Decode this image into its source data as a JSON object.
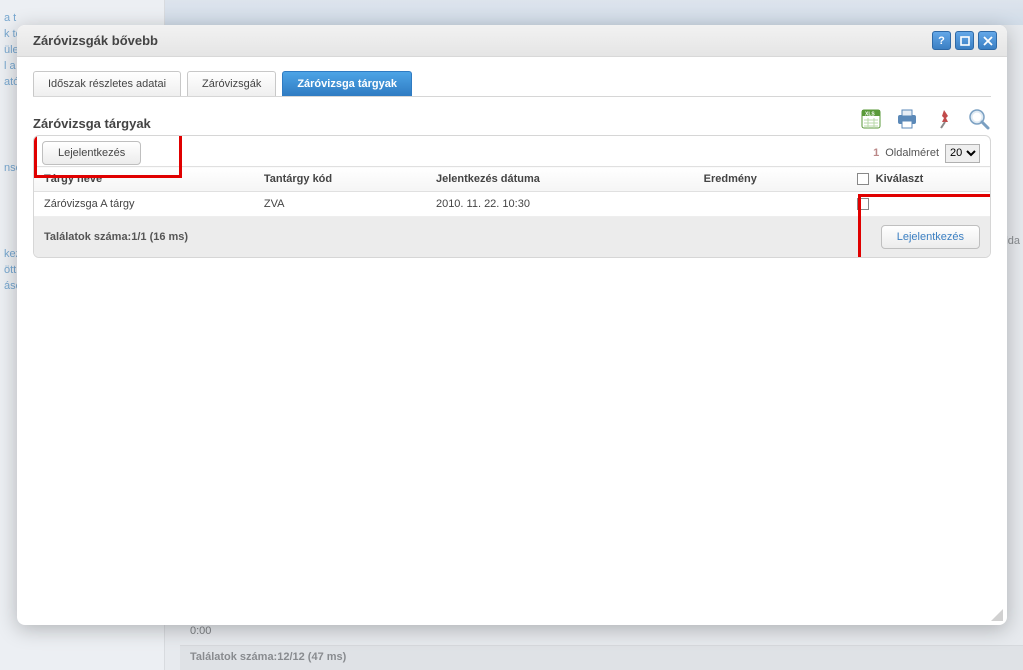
{
  "window": {
    "title": "Záróvizsgák bővebb",
    "tabs": [
      "Időszak részletes adatai",
      "Záróvizsgák",
      "Záróvizsga tárgyak"
    ],
    "activeTab": 2
  },
  "section": {
    "title": "Záróvizsga tárgyak"
  },
  "top_button": {
    "label": "Lejelentkezés"
  },
  "pager": {
    "pageNumber": "1",
    "sizeLabel": "Oldalméret",
    "size": "20"
  },
  "columns": [
    "Tárgy neve",
    "Tantárgy kód",
    "Jelentkezés dátuma",
    "Eredmény",
    "Kiválaszt"
  ],
  "rows": [
    {
      "name": "Záróvizsga A tárgy",
      "code": "ZVA",
      "date": "2010. 11. 22. 10:30",
      "result": ""
    }
  ],
  "footer": {
    "summary": "Találatok száma:1/1 (16 ms)",
    "button": "Lejelentkezés"
  },
  "background": {
    "leftnav": [
      "a t",
      "k tó",
      "ülett",
      "l a r",
      "atól",
      "",
      "",
      "nso",
      "",
      "",
      "",
      "kezé",
      "ött t",
      "ásol"
    ],
    "time_row": "0:00",
    "results": "Találatok száma:12/12 (47 ms)",
    "olda": "lda"
  }
}
